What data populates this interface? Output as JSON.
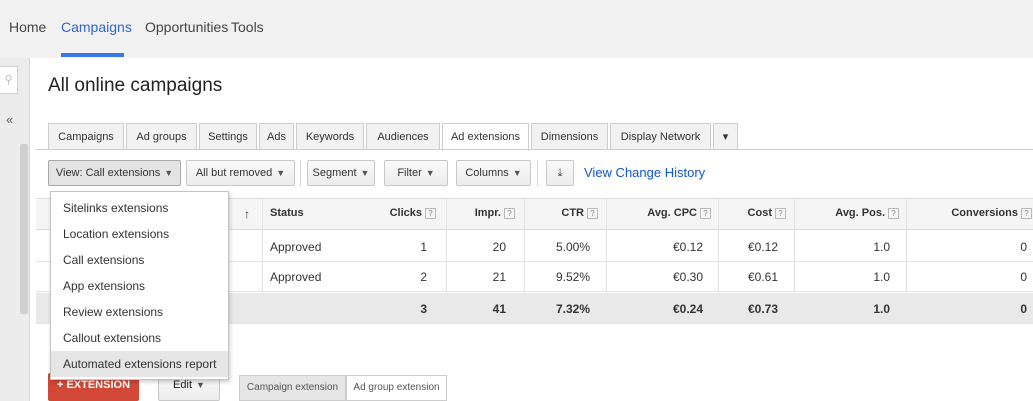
{
  "top_nav": {
    "items": [
      {
        "label": "Home"
      },
      {
        "label": "Campaigns"
      },
      {
        "label": "Opportunities"
      },
      {
        "label": "Tools"
      }
    ]
  },
  "page": {
    "title": "All online campaigns"
  },
  "tabs": [
    {
      "label": "Campaigns"
    },
    {
      "label": "Ad groups"
    },
    {
      "label": "Settings"
    },
    {
      "label": "Ads"
    },
    {
      "label": "Keywords"
    },
    {
      "label": "Audiences"
    },
    {
      "label": "Ad extensions"
    },
    {
      "label": "Dimensions"
    },
    {
      "label": "Display Network"
    }
  ],
  "toolbar": {
    "view": "View: Call extensions",
    "filter_removed": "All but removed",
    "segment": "Segment",
    "filter": "Filter",
    "columns": "Columns",
    "download_icon": "download-icon",
    "history": "View Change History"
  },
  "dropdown": {
    "items": [
      {
        "label": "Sitelinks extensions"
      },
      {
        "label": "Location extensions"
      },
      {
        "label": "Call extensions"
      },
      {
        "label": "App extensions"
      },
      {
        "label": "Review extensions"
      },
      {
        "label": "Callout extensions"
      },
      {
        "label": "Automated extensions report"
      }
    ]
  },
  "table": {
    "headers": {
      "status": "Status",
      "clicks": "Clicks",
      "impr": "Impr.",
      "ctr": "CTR",
      "avg_cpc": "Avg. CPC",
      "cost": "Cost",
      "avg_pos": "Avg. Pos.",
      "conversions": "Conversions"
    },
    "help_mark": "?",
    "sort_arrow": "↑",
    "rows": [
      {
        "status": "Approved",
        "clicks": "1",
        "impr": "20",
        "ctr": "5.00%",
        "avg_cpc": "€0.12",
        "cost": "€0.12",
        "avg_pos": "1.0",
        "conversions": "0"
      },
      {
        "status": "Approved",
        "clicks": "2",
        "impr": "21",
        "ctr": "9.52%",
        "avg_cpc": "€0.30",
        "cost": "€0.61",
        "avg_pos": "1.0",
        "conversions": "0"
      }
    ],
    "total": {
      "clicks": "3",
      "impr": "41",
      "ctr": "7.32%",
      "avg_cpc": "€0.24",
      "cost": "€0.73",
      "avg_pos": "1.0",
      "conversions": "0"
    }
  },
  "bottom": {
    "add_button": "+ EXTENSION",
    "edit_button": "Edit",
    "segment_tabs": [
      {
        "label": "Campaign extension"
      },
      {
        "label": "Ad group extension"
      }
    ]
  },
  "colors": {
    "accent": "#3366cc",
    "nav_underline": "#3b78e7",
    "add_button": "#d14836"
  }
}
